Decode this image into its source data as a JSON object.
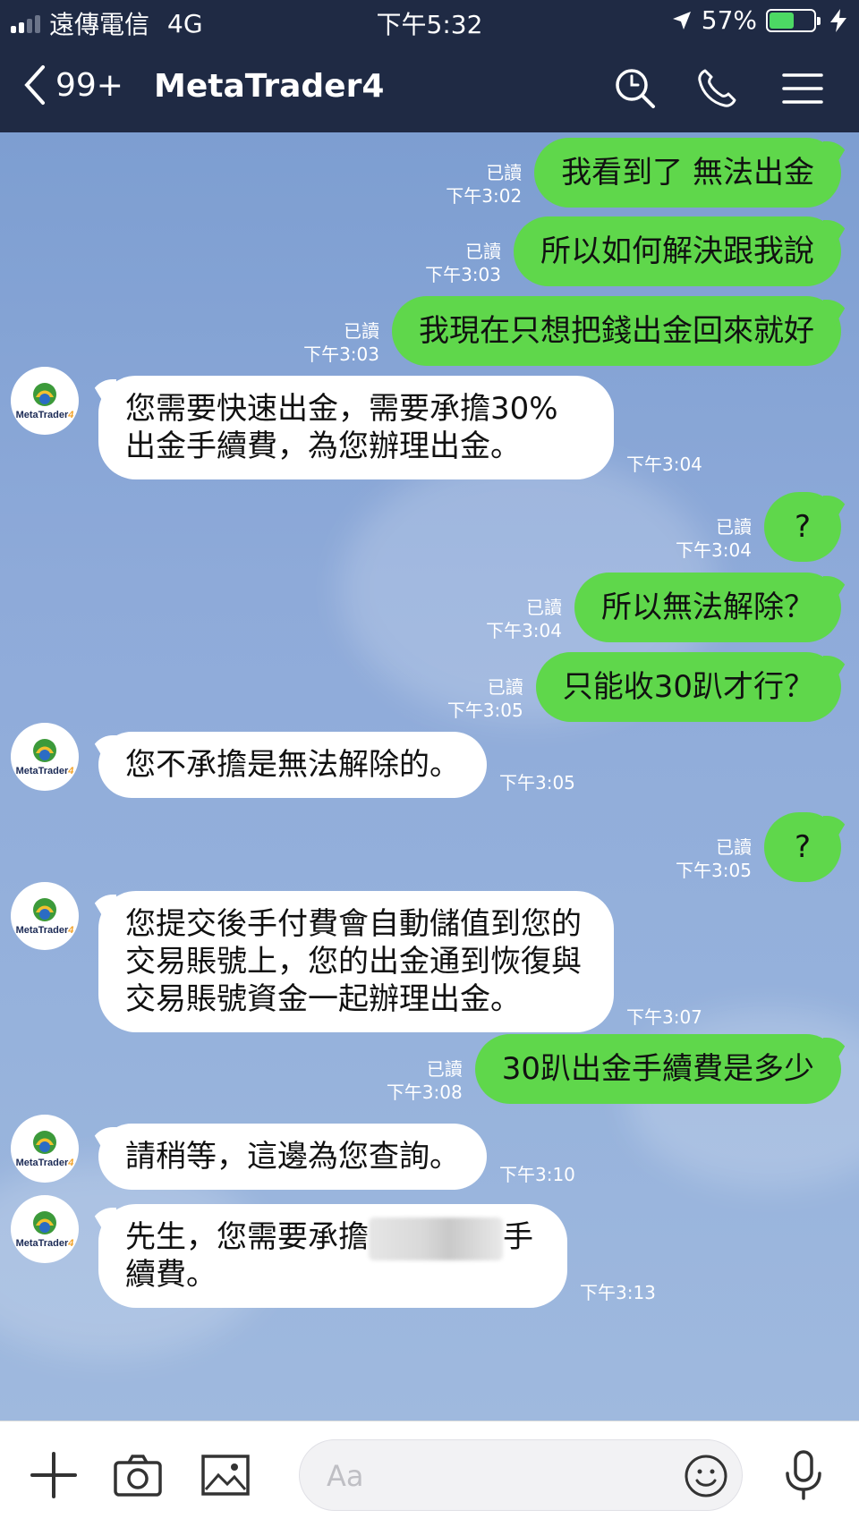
{
  "status_bar": {
    "carrier": "遠傳電信",
    "network": "4G",
    "time": "下午5:32",
    "battery_percent": "57%",
    "battery_level": 0.57
  },
  "nav": {
    "back_label": "99+",
    "title": "MetaTrader4"
  },
  "avatar": {
    "logo_text": "MetaTrader",
    "logo_suffix": "4"
  },
  "read_label": "已讀",
  "messages": [
    {
      "side": "out",
      "text": "我看到了 無法出金",
      "time": "下午3:02"
    },
    {
      "side": "out",
      "text": "所以如何解決跟我說",
      "time": "下午3:03"
    },
    {
      "side": "out",
      "text": "我現在只想把錢出金回來就好",
      "time": "下午3:03"
    },
    {
      "side": "in",
      "text": "您需要快速出金，需要承擔30%出金手續費，為您辦理出金。",
      "time": "下午3:04"
    },
    {
      "side": "out",
      "text": "?",
      "time": "下午3:04"
    },
    {
      "side": "out",
      "text": "所以無法解除？",
      "time": "下午3:04"
    },
    {
      "side": "out",
      "text": "只能收30趴才行？",
      "time": "下午3:05"
    },
    {
      "side": "in",
      "text": "您不承擔是無法解除的。",
      "time": "下午3:05"
    },
    {
      "side": "out",
      "text": "?",
      "time": "下午3:05"
    },
    {
      "side": "in",
      "text": "您提交後手付費會自動儲值到您的交易賬號上，您的出金通到恢復與交易賬號資金一起辦理出金。",
      "time": "下午3:07"
    },
    {
      "side": "out",
      "text": "30趴出金手續費是多少",
      "time": "下午3:08"
    },
    {
      "side": "in",
      "text": "請稍等，這邊為您查詢。",
      "time": "下午3:10"
    },
    {
      "side": "in",
      "text_before": "先生，您需要承擔",
      "text_after": "手續費。",
      "time": "下午3:13"
    }
  ],
  "input": {
    "placeholder": "Aa"
  },
  "colors": {
    "header_bg": "#1f2a44",
    "outgoing_bubble": "#5fd74b",
    "incoming_bubble": "#ffffff",
    "chat_bg": "#8eaad6"
  }
}
